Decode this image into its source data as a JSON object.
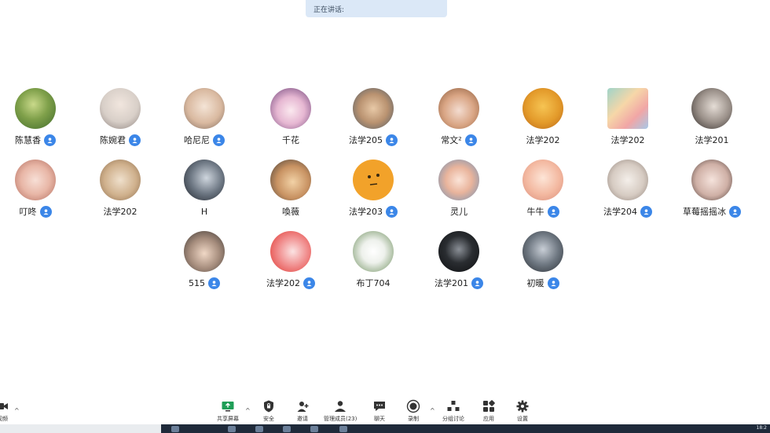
{
  "banner": {
    "text": "正在讲话:"
  },
  "participants": [
    {
      "name": "陈慧香",
      "verified": true
    },
    {
      "name": "陈婉君",
      "verified": true
    },
    {
      "name": "哈尼尼",
      "verified": true
    },
    {
      "name": "千花",
      "verified": false
    },
    {
      "name": "法学205",
      "verified": true
    },
    {
      "name": "常文²",
      "verified": true
    },
    {
      "name": "法学202",
      "verified": false
    },
    {
      "name": "法学202",
      "verified": false
    },
    {
      "name": "法学201",
      "verified": false
    },
    {
      "name": "叮咚",
      "verified": true
    },
    {
      "name": "法学202",
      "verified": false
    },
    {
      "name": "H",
      "verified": false
    },
    {
      "name": "喚薇",
      "verified": false
    },
    {
      "name": "法学203",
      "verified": true
    },
    {
      "name": "灵儿",
      "verified": false
    },
    {
      "name": "牛牛",
      "verified": true
    },
    {
      "name": "法学204",
      "verified": true
    },
    {
      "name": "草莓摇摇冰",
      "verified": true
    },
    {
      "name": "515",
      "verified": true
    },
    {
      "name": "法学202",
      "verified": true
    },
    {
      "name": "布丁704",
      "verified": false
    },
    {
      "name": "法学201",
      "verified": true
    },
    {
      "name": "初暖",
      "verified": true
    }
  ],
  "toolbar": {
    "video_label": "视频",
    "share_label": "共享屏幕",
    "security_label": "安全",
    "invite_label": "邀请",
    "members_label": "管理成员(23)",
    "chat_label": "聊天",
    "record_label": "录制",
    "breakout_label": "分组讨论",
    "apps_label": "应用",
    "settings_label": "设置"
  },
  "taskbar": {
    "clock": "18:2"
  },
  "colors": {
    "accent": "#3b86e8",
    "banner_bg": "#dbe8f7"
  }
}
